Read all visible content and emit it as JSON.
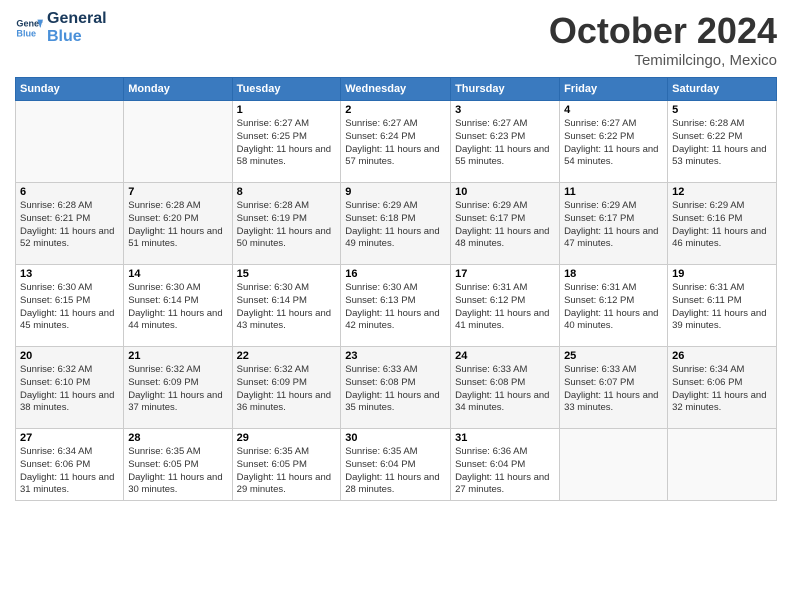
{
  "header": {
    "logo_line1": "General",
    "logo_line2": "Blue",
    "month": "October 2024",
    "location": "Temimilcingo, Mexico"
  },
  "weekdays": [
    "Sunday",
    "Monday",
    "Tuesday",
    "Wednesday",
    "Thursday",
    "Friday",
    "Saturday"
  ],
  "weeks": [
    [
      {
        "day": "",
        "info": ""
      },
      {
        "day": "",
        "info": ""
      },
      {
        "day": "1",
        "info": "Sunrise: 6:27 AM\nSunset: 6:25 PM\nDaylight: 11 hours and 58 minutes."
      },
      {
        "day": "2",
        "info": "Sunrise: 6:27 AM\nSunset: 6:24 PM\nDaylight: 11 hours and 57 minutes."
      },
      {
        "day": "3",
        "info": "Sunrise: 6:27 AM\nSunset: 6:23 PM\nDaylight: 11 hours and 55 minutes."
      },
      {
        "day": "4",
        "info": "Sunrise: 6:27 AM\nSunset: 6:22 PM\nDaylight: 11 hours and 54 minutes."
      },
      {
        "day": "5",
        "info": "Sunrise: 6:28 AM\nSunset: 6:22 PM\nDaylight: 11 hours and 53 minutes."
      }
    ],
    [
      {
        "day": "6",
        "info": "Sunrise: 6:28 AM\nSunset: 6:21 PM\nDaylight: 11 hours and 52 minutes."
      },
      {
        "day": "7",
        "info": "Sunrise: 6:28 AM\nSunset: 6:20 PM\nDaylight: 11 hours and 51 minutes."
      },
      {
        "day": "8",
        "info": "Sunrise: 6:28 AM\nSunset: 6:19 PM\nDaylight: 11 hours and 50 minutes."
      },
      {
        "day": "9",
        "info": "Sunrise: 6:29 AM\nSunset: 6:18 PM\nDaylight: 11 hours and 49 minutes."
      },
      {
        "day": "10",
        "info": "Sunrise: 6:29 AM\nSunset: 6:17 PM\nDaylight: 11 hours and 48 minutes."
      },
      {
        "day": "11",
        "info": "Sunrise: 6:29 AM\nSunset: 6:17 PM\nDaylight: 11 hours and 47 minutes."
      },
      {
        "day": "12",
        "info": "Sunrise: 6:29 AM\nSunset: 6:16 PM\nDaylight: 11 hours and 46 minutes."
      }
    ],
    [
      {
        "day": "13",
        "info": "Sunrise: 6:30 AM\nSunset: 6:15 PM\nDaylight: 11 hours and 45 minutes."
      },
      {
        "day": "14",
        "info": "Sunrise: 6:30 AM\nSunset: 6:14 PM\nDaylight: 11 hours and 44 minutes."
      },
      {
        "day": "15",
        "info": "Sunrise: 6:30 AM\nSunset: 6:14 PM\nDaylight: 11 hours and 43 minutes."
      },
      {
        "day": "16",
        "info": "Sunrise: 6:30 AM\nSunset: 6:13 PM\nDaylight: 11 hours and 42 minutes."
      },
      {
        "day": "17",
        "info": "Sunrise: 6:31 AM\nSunset: 6:12 PM\nDaylight: 11 hours and 41 minutes."
      },
      {
        "day": "18",
        "info": "Sunrise: 6:31 AM\nSunset: 6:12 PM\nDaylight: 11 hours and 40 minutes."
      },
      {
        "day": "19",
        "info": "Sunrise: 6:31 AM\nSunset: 6:11 PM\nDaylight: 11 hours and 39 minutes."
      }
    ],
    [
      {
        "day": "20",
        "info": "Sunrise: 6:32 AM\nSunset: 6:10 PM\nDaylight: 11 hours and 38 minutes."
      },
      {
        "day": "21",
        "info": "Sunrise: 6:32 AM\nSunset: 6:09 PM\nDaylight: 11 hours and 37 minutes."
      },
      {
        "day": "22",
        "info": "Sunrise: 6:32 AM\nSunset: 6:09 PM\nDaylight: 11 hours and 36 minutes."
      },
      {
        "day": "23",
        "info": "Sunrise: 6:33 AM\nSunset: 6:08 PM\nDaylight: 11 hours and 35 minutes."
      },
      {
        "day": "24",
        "info": "Sunrise: 6:33 AM\nSunset: 6:08 PM\nDaylight: 11 hours and 34 minutes."
      },
      {
        "day": "25",
        "info": "Sunrise: 6:33 AM\nSunset: 6:07 PM\nDaylight: 11 hours and 33 minutes."
      },
      {
        "day": "26",
        "info": "Sunrise: 6:34 AM\nSunset: 6:06 PM\nDaylight: 11 hours and 32 minutes."
      }
    ],
    [
      {
        "day": "27",
        "info": "Sunrise: 6:34 AM\nSunset: 6:06 PM\nDaylight: 11 hours and 31 minutes."
      },
      {
        "day": "28",
        "info": "Sunrise: 6:35 AM\nSunset: 6:05 PM\nDaylight: 11 hours and 30 minutes."
      },
      {
        "day": "29",
        "info": "Sunrise: 6:35 AM\nSunset: 6:05 PM\nDaylight: 11 hours and 29 minutes."
      },
      {
        "day": "30",
        "info": "Sunrise: 6:35 AM\nSunset: 6:04 PM\nDaylight: 11 hours and 28 minutes."
      },
      {
        "day": "31",
        "info": "Sunrise: 6:36 AM\nSunset: 6:04 PM\nDaylight: 11 hours and 27 minutes."
      },
      {
        "day": "",
        "info": ""
      },
      {
        "day": "",
        "info": ""
      }
    ]
  ]
}
